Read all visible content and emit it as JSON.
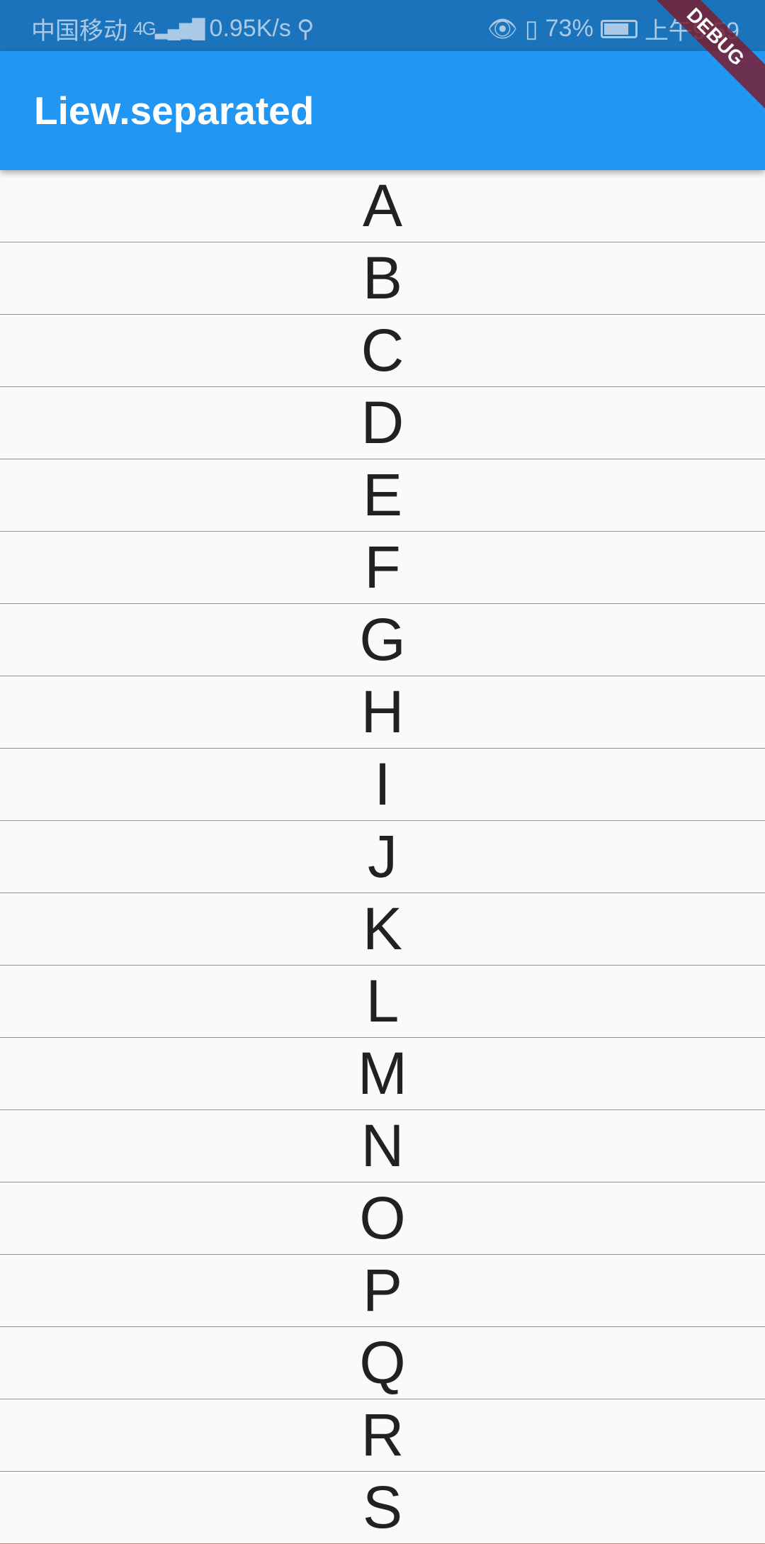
{
  "status_bar": {
    "carrier": "中国移动",
    "network": "4G",
    "speed": "0.95K/s",
    "battery": "73%",
    "time": "上午9:59"
  },
  "app_bar": {
    "title": "Liew.separated"
  },
  "debug_banner": "DEBUG",
  "colors": {
    "separator_odd": "#e57373",
    "separator_even": "#4a9fd8",
    "app_bar": "#2196f3"
  },
  "items": [
    "A",
    "B",
    "C",
    "D",
    "E",
    "F",
    "G",
    "H",
    "I",
    "J",
    "K",
    "L",
    "M",
    "N",
    "O",
    "P",
    "Q",
    "R",
    "S"
  ]
}
